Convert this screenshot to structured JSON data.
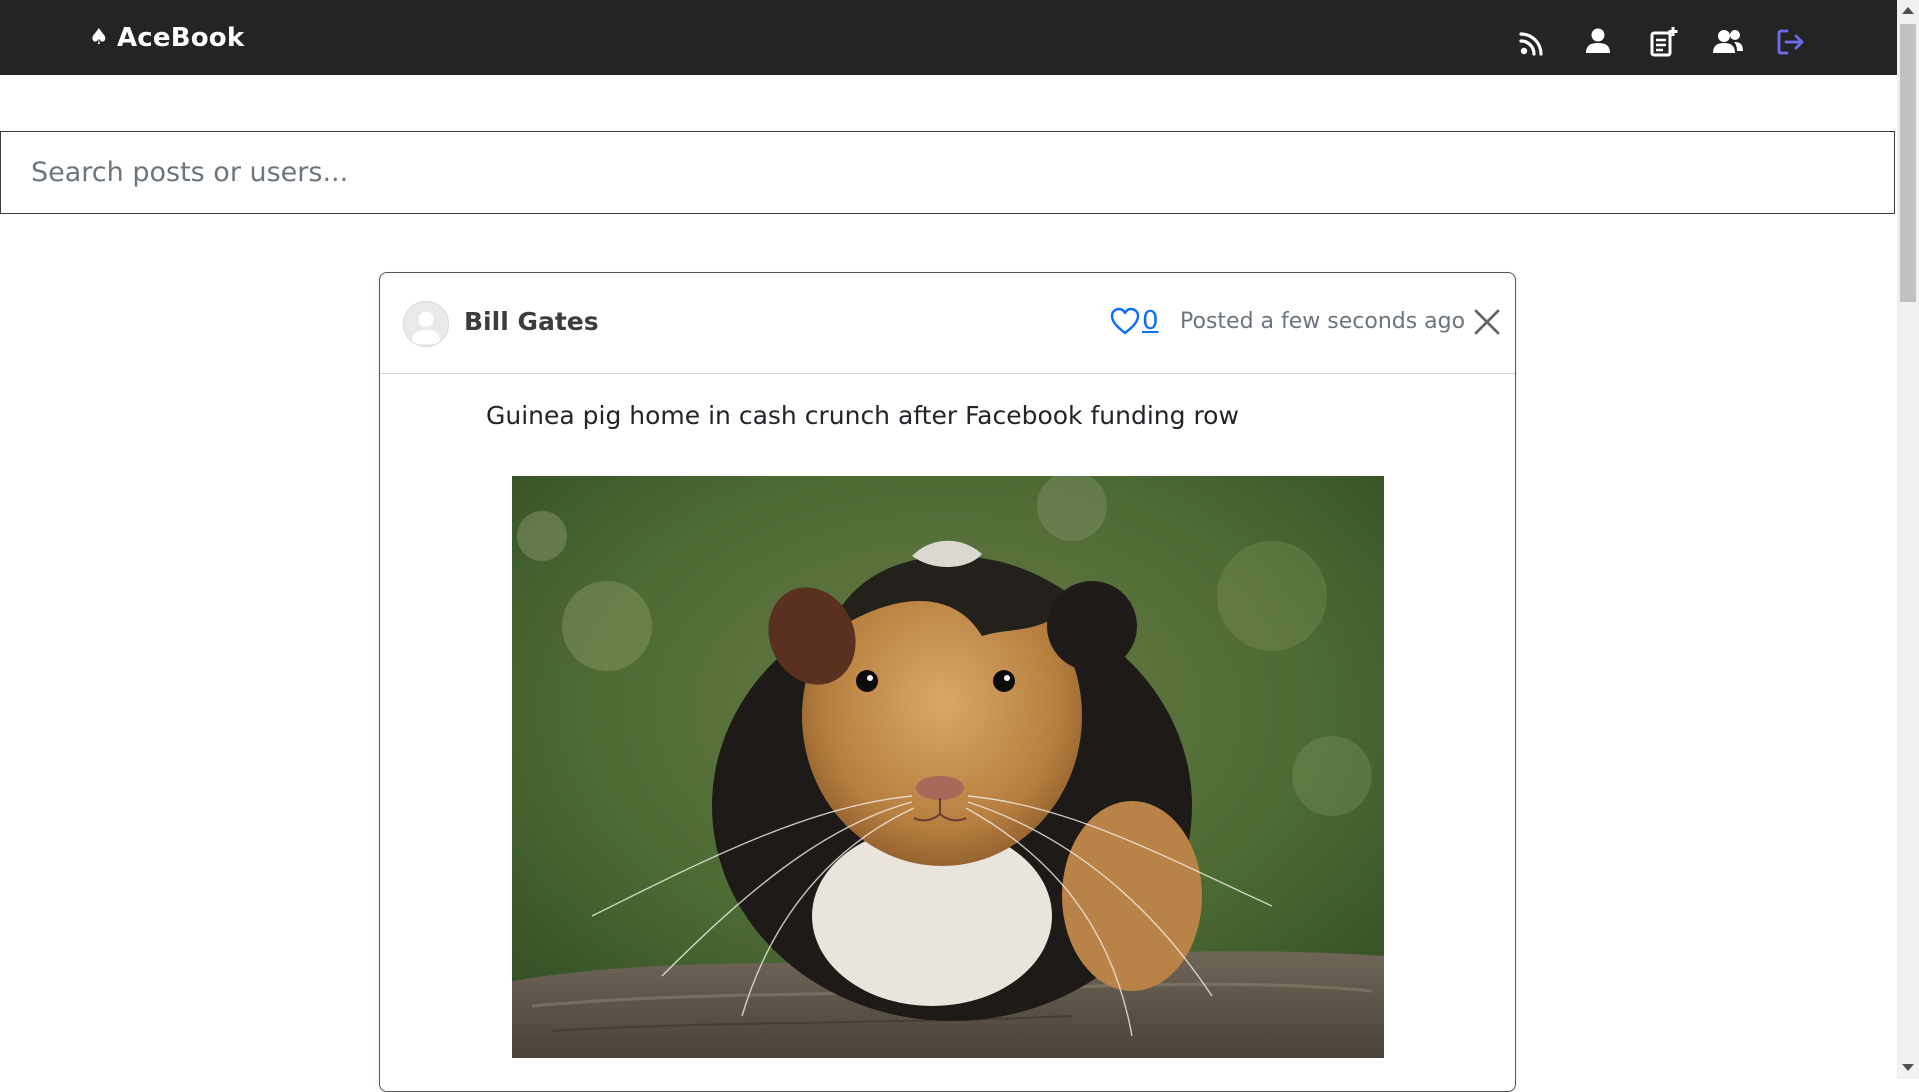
{
  "app": {
    "brand_icon": "spade-icon",
    "brand_name": "AceBook"
  },
  "nav": {
    "items": [
      {
        "name": "feed",
        "icon": "rss-icon",
        "color": "#ffffff"
      },
      {
        "name": "profile",
        "icon": "user-icon",
        "color": "#ffffff"
      },
      {
        "name": "new-post",
        "icon": "add-post-icon",
        "color": "#ffffff"
      },
      {
        "name": "friends",
        "icon": "users-icon",
        "color": "#ffffff"
      },
      {
        "name": "logout",
        "icon": "logout-icon",
        "color": "#6f6cf0"
      }
    ]
  },
  "search": {
    "placeholder": "Search posts or users...",
    "value": ""
  },
  "post": {
    "author": "Bill Gates",
    "avatar_icon": "default-avatar-icon",
    "likes": "0",
    "posted": "Posted a few seconds ago",
    "text": "Guinea pig home in cash crunch after Facebook funding row",
    "image": "guinea-pig-photo"
  },
  "colors": {
    "navbar_bg": "#242424",
    "link_blue": "#0d6efd",
    "logout_accent": "#6f6cf0"
  }
}
